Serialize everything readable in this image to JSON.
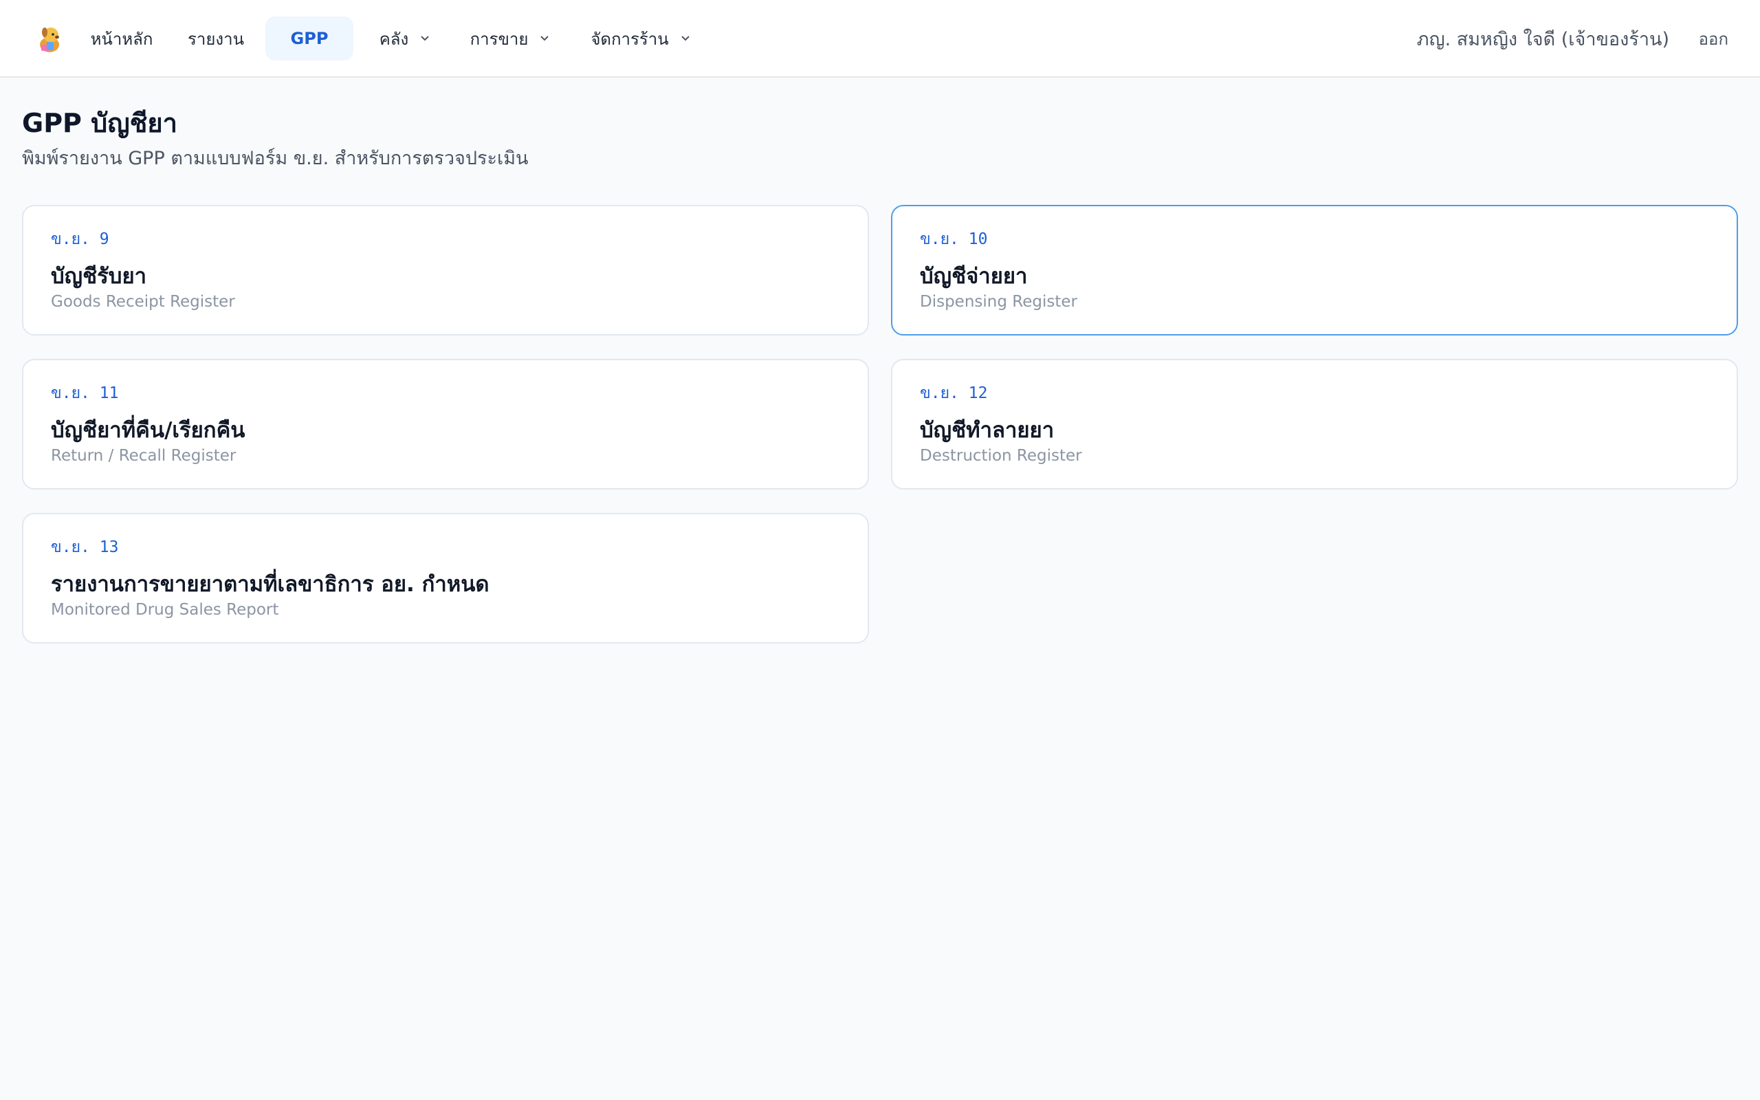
{
  "nav": {
    "items": [
      {
        "label": "หน้าหลัก",
        "active": false,
        "has_dropdown": false
      },
      {
        "label": "รายงาน",
        "active": false,
        "has_dropdown": false
      },
      {
        "label": "GPP",
        "active": true,
        "has_dropdown": false
      },
      {
        "label": "คลัง",
        "active": false,
        "has_dropdown": true
      },
      {
        "label": "การขาย",
        "active": false,
        "has_dropdown": true
      },
      {
        "label": "จัดการร้าน",
        "active": false,
        "has_dropdown": true
      }
    ],
    "user_name": "ภญ. สมหญิง ใจดี (เจ้าของร้าน)",
    "logout_label": "ออก",
    "logo_icon": "dog-mascot-icon"
  },
  "page": {
    "title": "GPP บัญชียา",
    "subtitle": "พิมพ์รายงาน GPP ตามแบบฟอร์ม ข.ย. สำหรับการตรวจประเมิน"
  },
  "cards": [
    {
      "code": "ข.ย. 9",
      "name": "บัญชีรับยา",
      "english": "Goods Receipt Register",
      "selected": false
    },
    {
      "code": "ข.ย. 10",
      "name": "บัญชีจ่ายยา",
      "english": "Dispensing Register",
      "selected": true
    },
    {
      "code": "ข.ย. 11",
      "name": "บัญชียาที่คืน/เรียกคืน",
      "english": "Return / Recall Register",
      "selected": false
    },
    {
      "code": "ข.ย. 12",
      "name": "บัญชีทำลายยา",
      "english": "Destruction Register",
      "selected": false
    },
    {
      "code": "ข.ย. 13",
      "name": "รายงานการขายยาตามที่เลขาธิการ อย. กำหนด",
      "english": "Monitored Drug Sales Report",
      "selected": false
    }
  ],
  "colors": {
    "accent": "#1d5fd6",
    "active_nav_bg": "#eef6ff",
    "selected_border": "#4d9ee8"
  }
}
